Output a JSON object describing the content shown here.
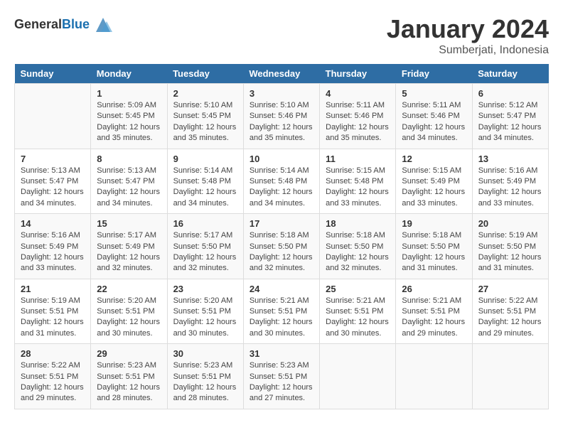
{
  "logo": {
    "general": "General",
    "blue": "Blue"
  },
  "title": "January 2024",
  "subtitle": "Sumberjati, Indonesia",
  "days_of_week": [
    "Sunday",
    "Monday",
    "Tuesday",
    "Wednesday",
    "Thursday",
    "Friday",
    "Saturday"
  ],
  "weeks": [
    [
      {
        "day": "",
        "info": ""
      },
      {
        "day": "1",
        "info": "Sunrise: 5:09 AM\nSunset: 5:45 PM\nDaylight: 12 hours\nand 35 minutes."
      },
      {
        "day": "2",
        "info": "Sunrise: 5:10 AM\nSunset: 5:45 PM\nDaylight: 12 hours\nand 35 minutes."
      },
      {
        "day": "3",
        "info": "Sunrise: 5:10 AM\nSunset: 5:46 PM\nDaylight: 12 hours\nand 35 minutes."
      },
      {
        "day": "4",
        "info": "Sunrise: 5:11 AM\nSunset: 5:46 PM\nDaylight: 12 hours\nand 35 minutes."
      },
      {
        "day": "5",
        "info": "Sunrise: 5:11 AM\nSunset: 5:46 PM\nDaylight: 12 hours\nand 34 minutes."
      },
      {
        "day": "6",
        "info": "Sunrise: 5:12 AM\nSunset: 5:47 PM\nDaylight: 12 hours\nand 34 minutes."
      }
    ],
    [
      {
        "day": "7",
        "info": "Sunrise: 5:13 AM\nSunset: 5:47 PM\nDaylight: 12 hours\nand 34 minutes."
      },
      {
        "day": "8",
        "info": "Sunrise: 5:13 AM\nSunset: 5:47 PM\nDaylight: 12 hours\nand 34 minutes."
      },
      {
        "day": "9",
        "info": "Sunrise: 5:14 AM\nSunset: 5:48 PM\nDaylight: 12 hours\nand 34 minutes."
      },
      {
        "day": "10",
        "info": "Sunrise: 5:14 AM\nSunset: 5:48 PM\nDaylight: 12 hours\nand 34 minutes."
      },
      {
        "day": "11",
        "info": "Sunrise: 5:15 AM\nSunset: 5:48 PM\nDaylight: 12 hours\nand 33 minutes."
      },
      {
        "day": "12",
        "info": "Sunrise: 5:15 AM\nSunset: 5:49 PM\nDaylight: 12 hours\nand 33 minutes."
      },
      {
        "day": "13",
        "info": "Sunrise: 5:16 AM\nSunset: 5:49 PM\nDaylight: 12 hours\nand 33 minutes."
      }
    ],
    [
      {
        "day": "14",
        "info": "Sunrise: 5:16 AM\nSunset: 5:49 PM\nDaylight: 12 hours\nand 33 minutes."
      },
      {
        "day": "15",
        "info": "Sunrise: 5:17 AM\nSunset: 5:49 PM\nDaylight: 12 hours\nand 32 minutes."
      },
      {
        "day": "16",
        "info": "Sunrise: 5:17 AM\nSunset: 5:50 PM\nDaylight: 12 hours\nand 32 minutes."
      },
      {
        "day": "17",
        "info": "Sunrise: 5:18 AM\nSunset: 5:50 PM\nDaylight: 12 hours\nand 32 minutes."
      },
      {
        "day": "18",
        "info": "Sunrise: 5:18 AM\nSunset: 5:50 PM\nDaylight: 12 hours\nand 32 minutes."
      },
      {
        "day": "19",
        "info": "Sunrise: 5:18 AM\nSunset: 5:50 PM\nDaylight: 12 hours\nand 31 minutes."
      },
      {
        "day": "20",
        "info": "Sunrise: 5:19 AM\nSunset: 5:50 PM\nDaylight: 12 hours\nand 31 minutes."
      }
    ],
    [
      {
        "day": "21",
        "info": "Sunrise: 5:19 AM\nSunset: 5:51 PM\nDaylight: 12 hours\nand 31 minutes."
      },
      {
        "day": "22",
        "info": "Sunrise: 5:20 AM\nSunset: 5:51 PM\nDaylight: 12 hours\nand 30 minutes."
      },
      {
        "day": "23",
        "info": "Sunrise: 5:20 AM\nSunset: 5:51 PM\nDaylight: 12 hours\nand 30 minutes."
      },
      {
        "day": "24",
        "info": "Sunrise: 5:21 AM\nSunset: 5:51 PM\nDaylight: 12 hours\nand 30 minutes."
      },
      {
        "day": "25",
        "info": "Sunrise: 5:21 AM\nSunset: 5:51 PM\nDaylight: 12 hours\nand 30 minutes."
      },
      {
        "day": "26",
        "info": "Sunrise: 5:21 AM\nSunset: 5:51 PM\nDaylight: 12 hours\nand 29 minutes."
      },
      {
        "day": "27",
        "info": "Sunrise: 5:22 AM\nSunset: 5:51 PM\nDaylight: 12 hours\nand 29 minutes."
      }
    ],
    [
      {
        "day": "28",
        "info": "Sunrise: 5:22 AM\nSunset: 5:51 PM\nDaylight: 12 hours\nand 29 minutes."
      },
      {
        "day": "29",
        "info": "Sunrise: 5:23 AM\nSunset: 5:51 PM\nDaylight: 12 hours\nand 28 minutes."
      },
      {
        "day": "30",
        "info": "Sunrise: 5:23 AM\nSunset: 5:51 PM\nDaylight: 12 hours\nand 28 minutes."
      },
      {
        "day": "31",
        "info": "Sunrise: 5:23 AM\nSunset: 5:51 PM\nDaylight: 12 hours\nand 27 minutes."
      },
      {
        "day": "",
        "info": ""
      },
      {
        "day": "",
        "info": ""
      },
      {
        "day": "",
        "info": ""
      }
    ]
  ]
}
